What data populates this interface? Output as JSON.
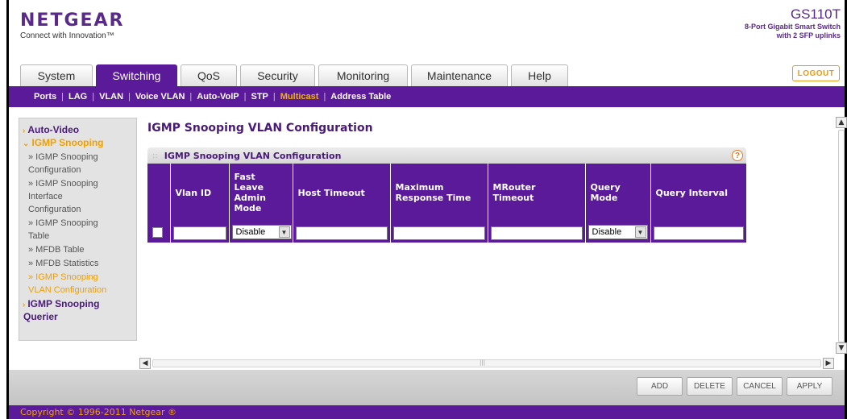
{
  "header": {
    "brand": "NETGEAR",
    "tagline": "Connect with Innovation™",
    "model": "GS110T",
    "desc_line1": "8-Port Gigabit Smart Switch",
    "desc_line2": "with 2 SFP uplinks",
    "logout_label": "LOGOUT"
  },
  "tabs": [
    {
      "label": "System",
      "active": false
    },
    {
      "label": "Switching",
      "active": true
    },
    {
      "label": "QoS",
      "active": false
    },
    {
      "label": "Security",
      "active": false
    },
    {
      "label": "Monitoring",
      "active": false
    },
    {
      "label": "Maintenance",
      "active": false
    },
    {
      "label": "Help",
      "active": false
    }
  ],
  "subnav": [
    "Ports",
    "LAG",
    "VLAN",
    "Voice VLAN",
    "Auto-VoIP",
    "STP",
    "Multicast",
    "Address Table"
  ],
  "subnav_active": "Multicast",
  "menu": {
    "auto_video": "Auto-Video",
    "igmp_snooping": "IGMP Snooping",
    "sub_items": [
      [
        "» IGMP Snooping",
        "Configuration"
      ],
      [
        "» IGMP Snooping",
        "Interface",
        "Configuration"
      ],
      [
        "» IGMP Snooping",
        "Table"
      ],
      [
        "» MFDB Table"
      ],
      [
        "» MFDB Statistics"
      ],
      [
        "» IGMP Snooping",
        "VLAN Configuration"
      ]
    ],
    "querier_line1": "IGMP Snooping",
    "querier_line2": "Querier"
  },
  "main": {
    "page_title": "IGMP Snooping VLAN Configuration",
    "panel_title": "IGMP Snooping VLAN Configuration",
    "columns": [
      [
        "Vlan ID"
      ],
      [
        "Fast",
        "Leave",
        "Admin",
        "Mode"
      ],
      [
        "Host Timeout"
      ],
      [
        "Maximum",
        "Response Time"
      ],
      [
        "MRouter",
        "Timeout"
      ],
      [
        "Query",
        "Mode"
      ],
      [
        "Query Interval"
      ]
    ],
    "row": {
      "fast_leave": "Disable",
      "query_mode": "Disable"
    }
  },
  "footer": {
    "buttons": [
      "ADD",
      "DELETE",
      "CANCEL",
      "APPLY"
    ],
    "copyright": "Copyright © 1996-2011 Netgear ®"
  },
  "colors": {
    "purple": "#5a1a9a",
    "orange": "#f0a000"
  }
}
